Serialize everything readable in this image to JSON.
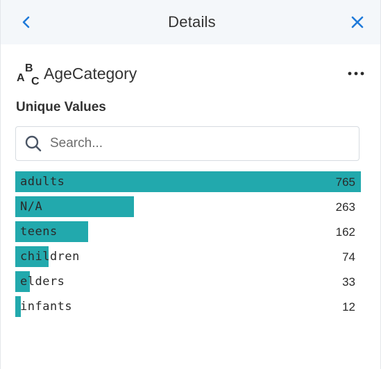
{
  "header": {
    "title": "Details",
    "back_icon": "chevron-left-icon",
    "close_icon": "close-icon",
    "accent_color": "#1f7ad9"
  },
  "field": {
    "type_icon": "abc-text-type-icon",
    "name": "AgeCategory",
    "menu_icon": "more-horizontal-icon"
  },
  "unique_values": {
    "title": "Unique Values",
    "search_placeholder": "Search...",
    "bar_color": "#22a9ad",
    "max_count": 765,
    "items": [
      {
        "label": "adults",
        "count": 765
      },
      {
        "label": "N/A",
        "count": 263
      },
      {
        "label": "teens",
        "count": 162
      },
      {
        "label": "children",
        "count": 74
      },
      {
        "label": "elders",
        "count": 33
      },
      {
        "label": "infants",
        "count": 12
      }
    ]
  }
}
